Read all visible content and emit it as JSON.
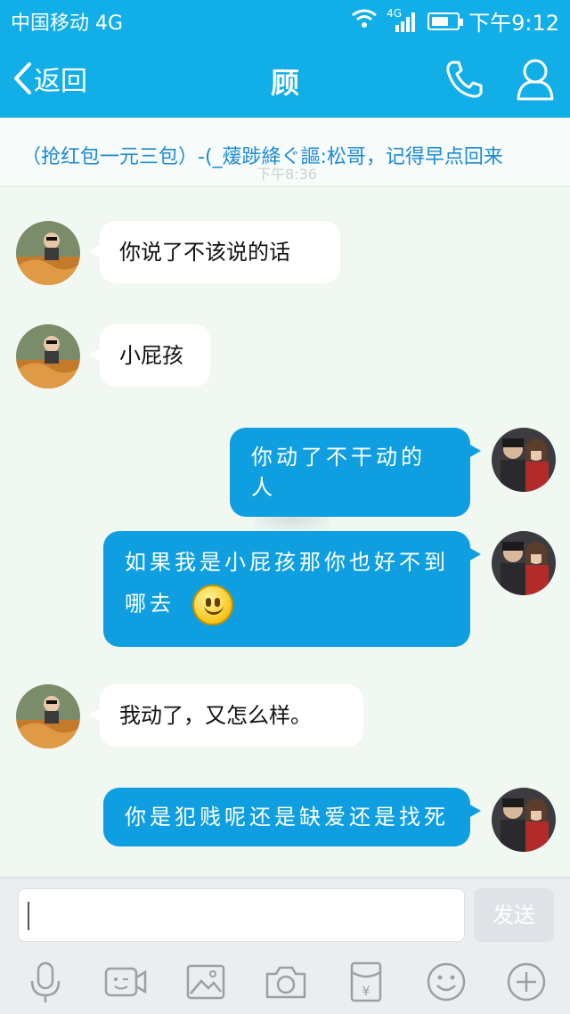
{
  "status": {
    "carrier": "中国移动 4G",
    "network_badge": "4G",
    "time": "下午9:12",
    "battery_level": 0.65
  },
  "header": {
    "back_label": "返回",
    "title": "顾"
  },
  "ticker": {
    "text": "（抢红包一元三包）-(_蕿踄絳ぐ謳:松哥，记得早点回来",
    "ghost_time": "下午8:36"
  },
  "messages": [
    {
      "direction": "in",
      "text": "你说了不该说的话"
    },
    {
      "direction": "in",
      "text": "小屁孩"
    },
    {
      "direction": "out",
      "text": "你动了不干动的人"
    },
    {
      "direction": "out",
      "text_line1": "如果我是小屁孩那你也好不到",
      "text_line2": "哪去",
      "emoji": "smiley-emoji"
    },
    {
      "direction": "in",
      "text": "我动了，又怎么样。"
    },
    {
      "direction": "out",
      "text": "你是犯贱呢还是缺爱还是找死"
    }
  ],
  "input": {
    "value": "",
    "send_label": "发送"
  },
  "toolbar_icons": [
    "microphone-icon",
    "video-icon",
    "image-icon",
    "camera-icon",
    "red-envelope-icon",
    "emoji-icon",
    "plus-icon"
  ],
  "colors": {
    "header_blue": "#12aee8",
    "bubble_out": "#0f9fe0",
    "ticker_text": "#1d8bd4"
  }
}
